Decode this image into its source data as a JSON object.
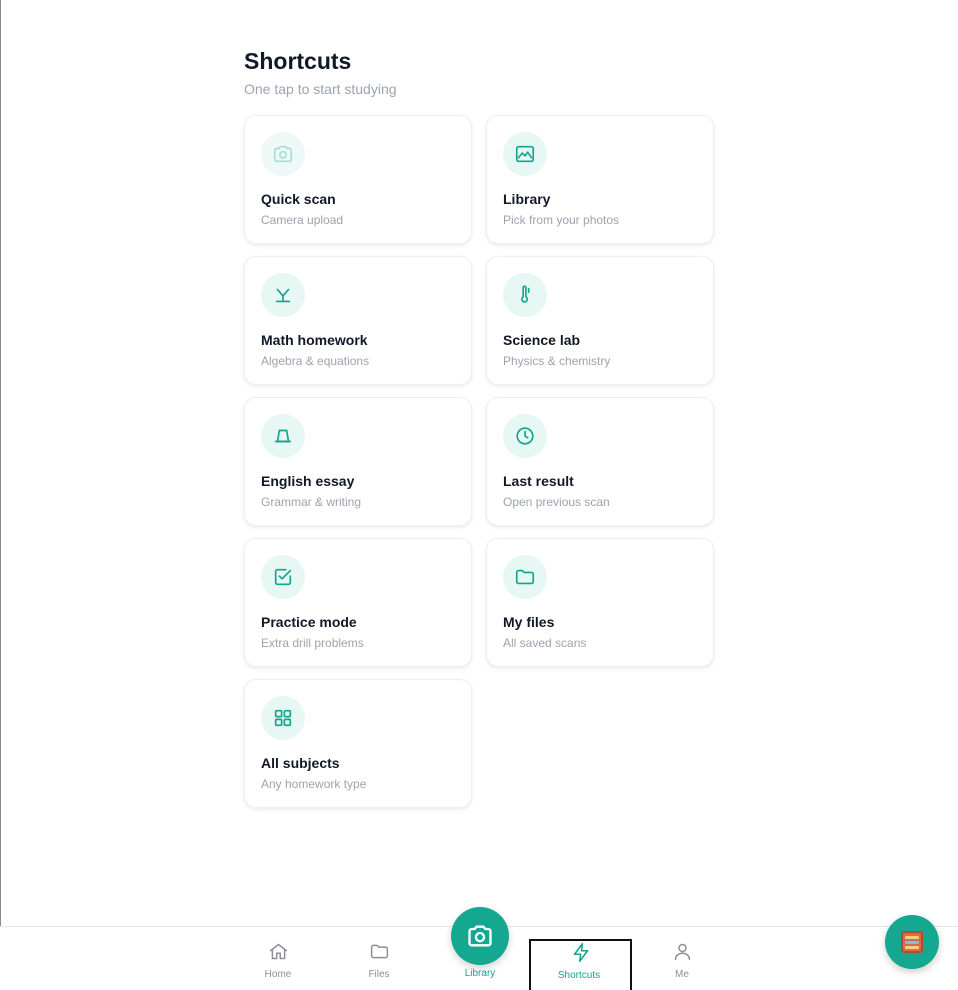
{
  "header": {
    "title": "Shortcuts",
    "subtitle": "One tap to start studying"
  },
  "cards": [
    {
      "title": "Quick scan",
      "subtitle": "Camera upload",
      "icon": "camera-icon"
    },
    {
      "title": "Library",
      "subtitle": "Pick from your photos",
      "icon": "image-icon"
    },
    {
      "title": "Math homework",
      "subtitle": "Algebra & equations",
      "icon": "math-icon"
    },
    {
      "title": "Science lab",
      "subtitle": "Physics & chemistry",
      "icon": "thermometer-icon"
    },
    {
      "title": "English essay",
      "subtitle": "Grammar & writing",
      "icon": "book-icon"
    },
    {
      "title": "Last result",
      "subtitle": "Open previous scan",
      "icon": "clock-icon"
    },
    {
      "title": "Practice mode",
      "subtitle": "Extra drill problems",
      "icon": "checkbox-icon"
    },
    {
      "title": "My files",
      "subtitle": "All saved scans",
      "icon": "folder-icon"
    },
    {
      "title": "All subjects",
      "subtitle": "Any homework type",
      "icon": "grid-icon"
    }
  ],
  "nav": {
    "home": "Home",
    "files": "Files",
    "library": "Library",
    "shortcuts": "Shortcuts",
    "me": "Me"
  },
  "colors": {
    "accent": "#14a890",
    "icon_bg": "#e6f7f4",
    "muted_text": "#9ca3af"
  }
}
